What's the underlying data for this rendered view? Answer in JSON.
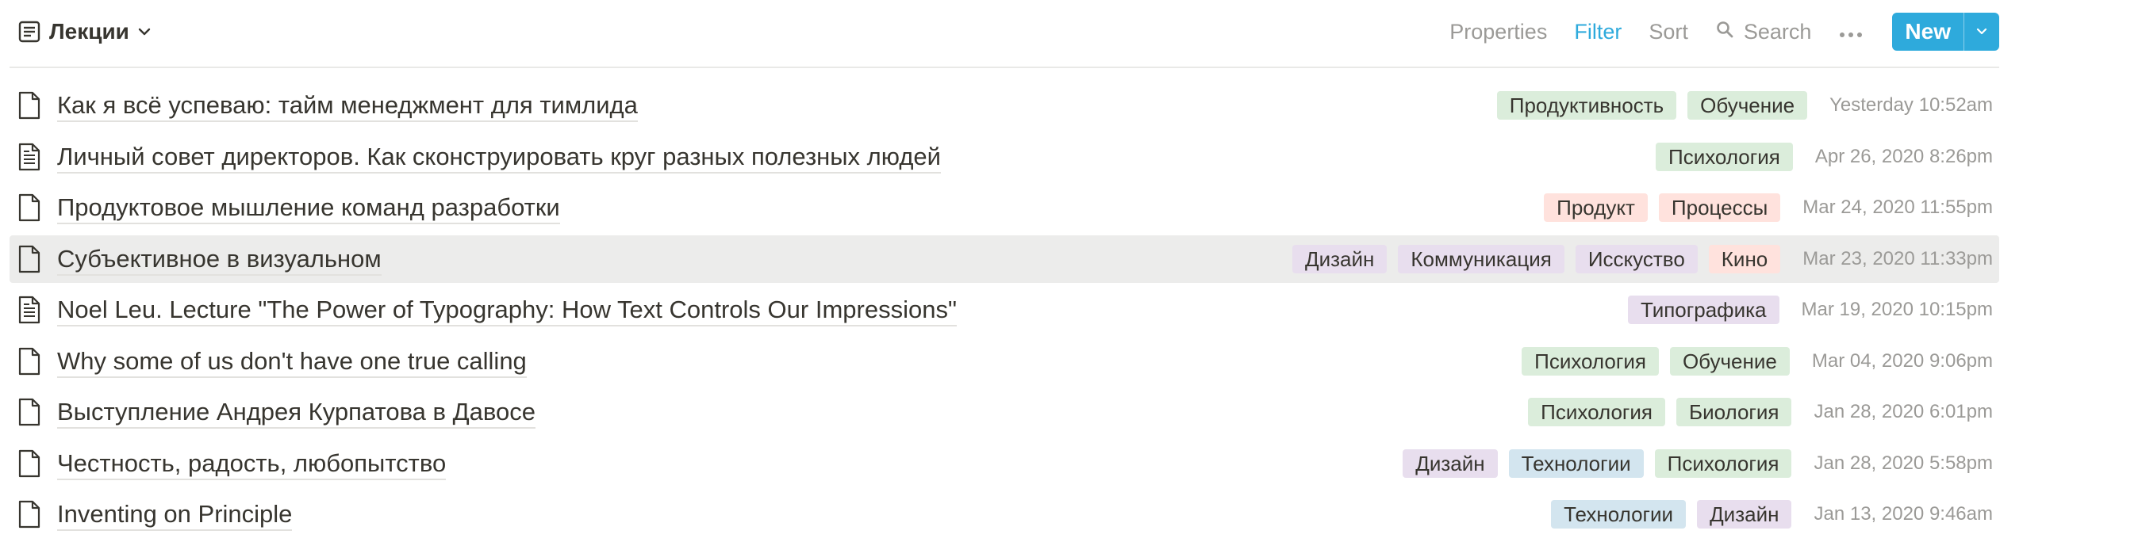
{
  "header": {
    "title": "Лекции",
    "properties_label": "Properties",
    "filter_label": "Filter",
    "sort_label": "Sort",
    "search_label": "Search",
    "new_label": "New"
  },
  "tag_colors": {
    "green": "#dbeddb",
    "red": "#ffe2dd",
    "purple": "#e8deee",
    "blue": "#d3e5ef"
  },
  "rows": [
    {
      "title": "Как я всё успеваю: тайм менеджмент для тимлида",
      "icon": "page-icon",
      "tags": [
        {
          "label": "Продуктивность",
          "color": "green"
        },
        {
          "label": "Обучение",
          "color": "green"
        }
      ],
      "date": "Yesterday 10:52am"
    },
    {
      "title": "Личный совет директоров. Как сконструировать круг разных полезных людей",
      "icon": "page-text-icon",
      "tags": [
        {
          "label": "Психология",
          "color": "green"
        }
      ],
      "date": "Apr 26, 2020 8:26pm"
    },
    {
      "title": "Продуктовое мышление команд разработки",
      "icon": "page-icon",
      "tags": [
        {
          "label": "Продукт",
          "color": "red"
        },
        {
          "label": "Процессы",
          "color": "red"
        }
      ],
      "date": "Mar 24, 2020 11:55pm"
    },
    {
      "title": "Субъективное в визуальном",
      "icon": "page-icon",
      "tags": [
        {
          "label": "Дизайн",
          "color": "purple"
        },
        {
          "label": "Коммуникация",
          "color": "purple"
        },
        {
          "label": "Исскуство",
          "color": "purple"
        },
        {
          "label": "Кино",
          "color": "red"
        }
      ],
      "date": "Mar 23, 2020 11:33pm",
      "highlighted": true
    },
    {
      "title": "Noel Leu. Lecture \"The Power of Typography: How Text Controls Our Impressions\"",
      "icon": "page-text-icon",
      "tags": [
        {
          "label": "Типографика",
          "color": "purple"
        }
      ],
      "date": "Mar 19, 2020 10:15pm"
    },
    {
      "title": "Why some of us don't have one true calling",
      "icon": "page-icon",
      "tags": [
        {
          "label": "Психология",
          "color": "green"
        },
        {
          "label": "Обучение",
          "color": "green"
        }
      ],
      "date": "Mar 04, 2020 9:06pm"
    },
    {
      "title": "Выступление Андрея Курпатова в Давосе",
      "icon": "page-icon",
      "tags": [
        {
          "label": "Психология",
          "color": "green"
        },
        {
          "label": "Биология",
          "color": "green"
        }
      ],
      "date": "Jan 28, 2020 6:01pm"
    },
    {
      "title": "Честность, радость, любопытство",
      "icon": "page-icon",
      "tags": [
        {
          "label": "Дизайн",
          "color": "purple"
        },
        {
          "label": "Технологии",
          "color": "blue"
        },
        {
          "label": "Психология",
          "color": "green"
        }
      ],
      "date": "Jan 28, 2020 5:58pm"
    },
    {
      "title": "Inventing on Principle",
      "icon": "page-icon",
      "tags": [
        {
          "label": "Технологии",
          "color": "blue"
        },
        {
          "label": "Дизайн",
          "color": "purple"
        }
      ],
      "date": "Jan 13, 2020 9:46am"
    }
  ]
}
